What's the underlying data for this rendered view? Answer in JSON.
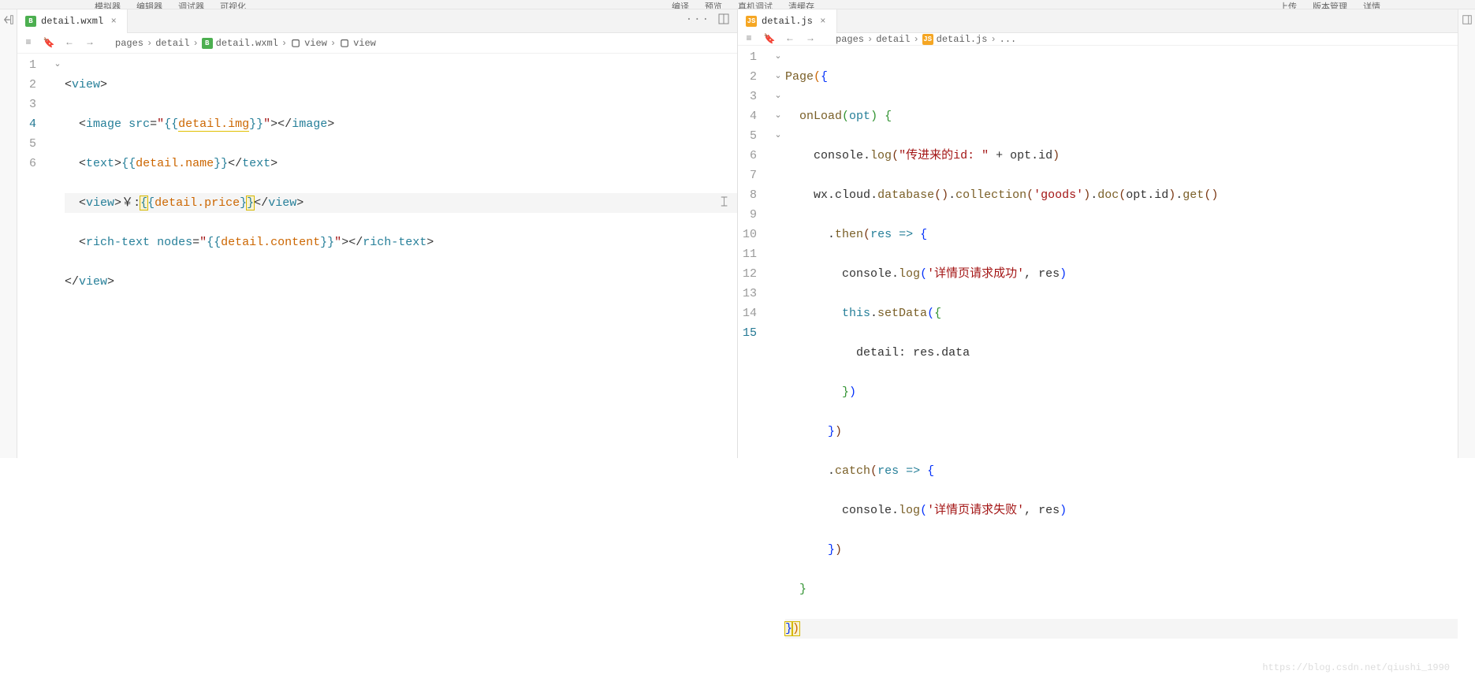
{
  "top_menu": {
    "left": [
      "模拟器",
      "编辑器",
      "调试器",
      "可视化"
    ],
    "right_left": [
      "编译",
      "预览",
      "真机调试",
      "清缓存"
    ],
    "right": [
      "上传",
      "版本管理",
      "详情"
    ]
  },
  "left_pane": {
    "tab": {
      "icon_label": "B",
      "filename": "detail.wxml"
    },
    "breadcrumbs": {
      "items": [
        "pages",
        "detail",
        "detail.wxml",
        "view",
        "view"
      ]
    },
    "code": {
      "lines": [
        {
          "n": "1",
          "content": "<view>"
        },
        {
          "n": "2",
          "content": "  <image src=\"{{detail.img}}\"></image>"
        },
        {
          "n": "3",
          "content": "  <text>{{detail.name}}</text>"
        },
        {
          "n": "4",
          "content": "  <view>￥:{{detail.price}}</view>"
        },
        {
          "n": "5",
          "content": "  <rich-text nodes=\"{{detail.content}}\"></rich-text>"
        },
        {
          "n": "6",
          "content": "</view>"
        }
      ],
      "bindings": {
        "img": "detail.img",
        "name": "detail.name",
        "price": "detail.price",
        "content": "detail.content"
      }
    }
  },
  "right_pane": {
    "tab": {
      "icon_label": "JS",
      "filename": "detail.js"
    },
    "breadcrumbs": {
      "items": [
        "pages",
        "detail",
        "detail.js",
        "..."
      ]
    },
    "code": {
      "page_fn": "Page",
      "onload": "onLoad",
      "opt": "opt",
      "log1_str": "\"传进来的id: \"",
      "log1_expr": "opt.id",
      "chain": {
        "wx": "wx",
        "cloud": "cloud",
        "database": "database",
        "collection": "collection",
        "collection_arg": "'goods'",
        "doc": "doc",
        "doc_arg": "opt.id",
        "get": "get"
      },
      "then": "then",
      "res": "res",
      "arrow": "=>",
      "log2_str": "'详情页请求成功'",
      "log2_arg": "res",
      "this": "this",
      "setData": "setData",
      "detail_key": "detail",
      "res_data": "res.data",
      "catch": "catch",
      "log3_str": "'详情页请求失败'",
      "log3_arg": "res",
      "line_count": 15
    }
  },
  "watermark": "https://blog.csdn.net/qiushi_1990"
}
